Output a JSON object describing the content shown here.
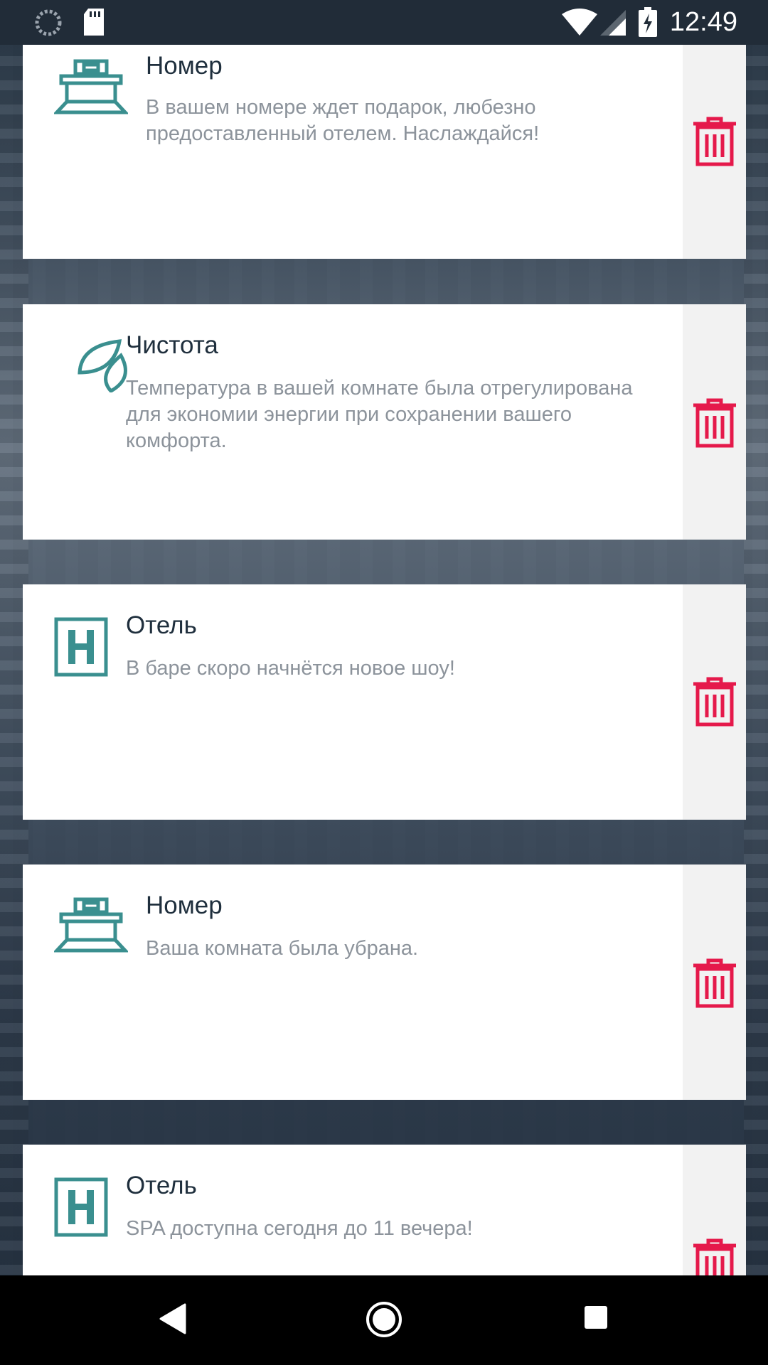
{
  "status_bar": {
    "time": "12:49",
    "icons": [
      "loading-icon",
      "sd-card-icon",
      "wifi-icon",
      "signal-icon",
      "battery-charging-icon"
    ]
  },
  "notifications": [
    {
      "icon": "room-bed-icon",
      "title": "Номер",
      "message": "В вашем номере ждет подарок, любезно предоставленный отелем. Наслаждайся!"
    },
    {
      "icon": "leaf-icon",
      "title": "Чистота",
      "message": "Температура в вашей комнате была отрегулирована для экономии энергии при сохранении вашего комфорта."
    },
    {
      "icon": "hotel-h-icon",
      "title": "Отель",
      "message": "В баре скоро начнётся новое шоу!"
    },
    {
      "icon": "room-bed-icon",
      "title": "Номер",
      "message": "Ваша комната была убрана."
    },
    {
      "icon": "hotel-h-icon",
      "title": "Отель",
      "message": "SPA доступна сегодня до 11 вечера!"
    }
  ],
  "colors": {
    "icon_teal": "#3a8f8f",
    "trash_red": "#e5194b",
    "title": "#1f2f3d",
    "message": "#8c939b",
    "status_bar": "#212c38"
  },
  "nav_bar": {
    "icons": [
      "back-icon",
      "home-icon",
      "recents-icon"
    ]
  }
}
